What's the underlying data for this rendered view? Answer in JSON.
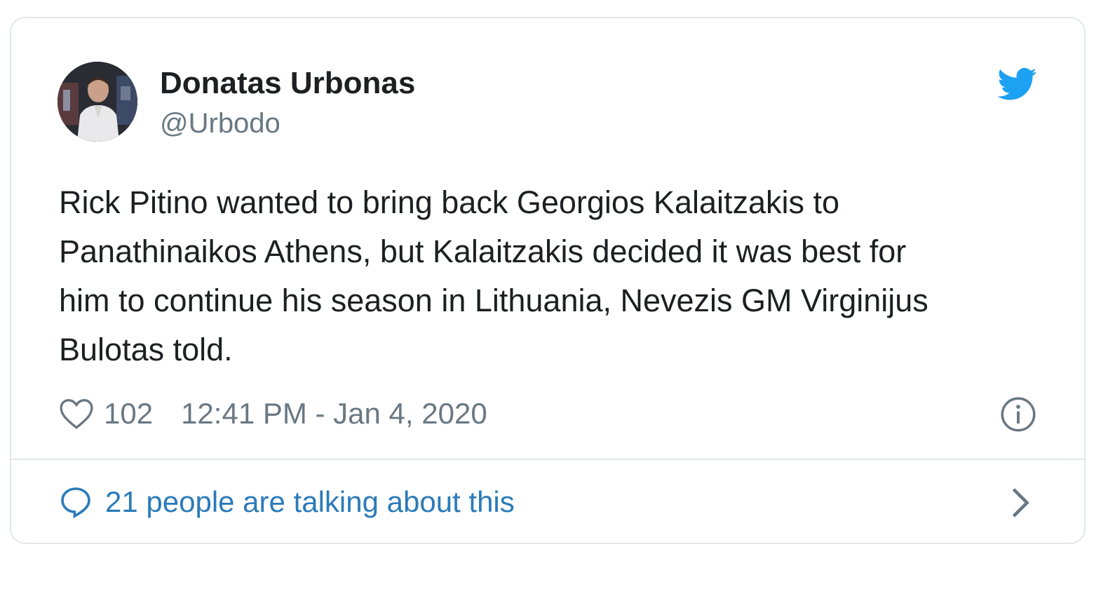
{
  "author": {
    "name": "Donatas Urbonas",
    "handle": "@Urbodo"
  },
  "tweet": {
    "lines": [
      "Rick Pitino wanted to bring back Georgios Kalaitzakis to",
      "Panathinaikos Athens, but Kalaitzakis decided it was best for",
      "him to continue his season in Lithuania, Nevezis GM Virginijus",
      "Bulotas told."
    ]
  },
  "meta": {
    "likes": "102",
    "timestamp": "12:41 PM - Jan 4, 2020"
  },
  "footer": {
    "talking_label": "21 people are talking about this"
  },
  "icons": {
    "brand": "twitter-bird-icon",
    "like": "heart-icon",
    "info": "info-icon",
    "reply": "speech-bubble-icon",
    "more": "chevron-right-icon"
  },
  "colors": {
    "twitter_blue": "#1da1f2",
    "link_blue": "#2b7bb9",
    "text": "#1c2022",
    "muted": "#697882",
    "border": "#e1e8ed"
  }
}
